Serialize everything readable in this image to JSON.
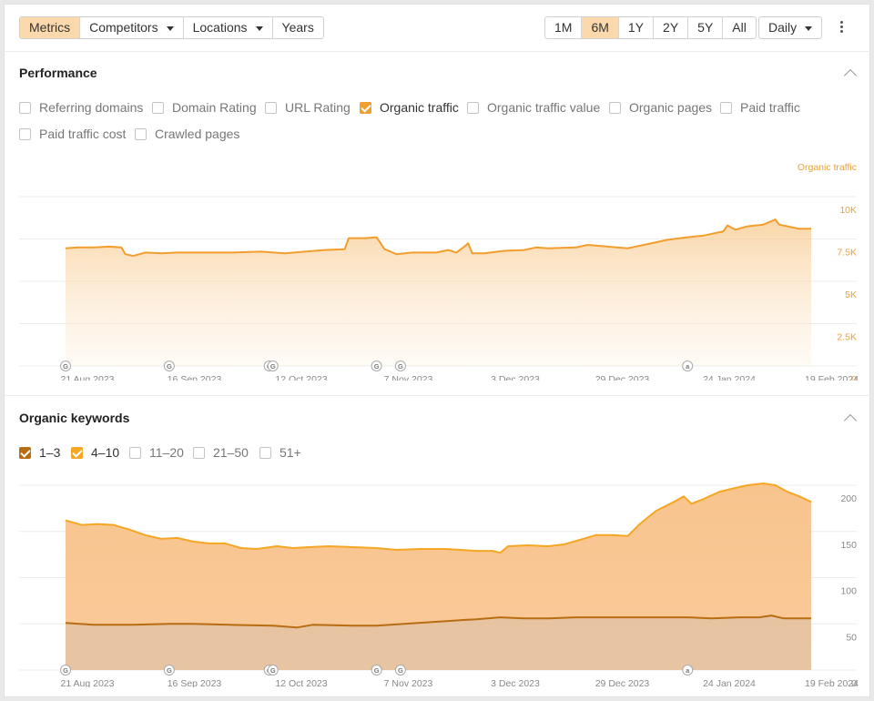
{
  "toolbar": {
    "views": [
      {
        "label": "Metrics",
        "active": true
      },
      {
        "label": "Competitors",
        "dropdown": true
      },
      {
        "label": "Locations",
        "dropdown": true
      },
      {
        "label": "Years"
      }
    ],
    "ranges": [
      {
        "label": "1M"
      },
      {
        "label": "6M",
        "active": true
      },
      {
        "label": "1Y"
      },
      {
        "label": "2Y"
      },
      {
        "label": "5Y"
      },
      {
        "label": "All"
      }
    ],
    "granularity": "Daily",
    "more_icon": "vertical-dots-icon"
  },
  "performance": {
    "title": "Performance",
    "collapse_icon": "chevron-up-icon",
    "metrics": [
      {
        "label": "Referring domains",
        "checked": false
      },
      {
        "label": "Domain Rating",
        "checked": false
      },
      {
        "label": "URL Rating",
        "checked": false
      },
      {
        "label": "Organic traffic",
        "checked": true
      },
      {
        "label": "Organic traffic value",
        "checked": false
      },
      {
        "label": "Organic pages",
        "checked": false
      },
      {
        "label": "Paid traffic",
        "checked": false
      },
      {
        "label": "Paid traffic cost",
        "checked": false
      },
      {
        "label": "Crawled pages",
        "checked": false
      }
    ],
    "accent": "#f29e2e"
  },
  "keywords": {
    "title": "Organic keywords",
    "collapse_icon": "chevron-up-icon",
    "filters": [
      {
        "label": "1–3",
        "checked": true,
        "color": "#b86d12"
      },
      {
        "label": "4–10",
        "checked": true,
        "color": "#f5a623"
      },
      {
        "label": "11–20",
        "checked": false
      },
      {
        "label": "21–50",
        "checked": false
      },
      {
        "label": "51+",
        "checked": false
      }
    ]
  },
  "chart_data": [
    {
      "type": "area",
      "series": [
        {
          "name": "Organic traffic",
          "color": "#f29e2e"
        }
      ],
      "x_ticks": [
        "21 Aug 2023",
        "16 Sep 2023",
        "12 Oct 2023",
        "7 Nov 2023",
        "3 Dec 2023",
        "29 Dec 2023",
        "24 Jan 2024",
        "19 Feb 2024"
      ],
      "y_ticks": [
        "0",
        "2.5K",
        "5K",
        "7.5K",
        "10K"
      ],
      "ylim": [
        0,
        10000
      ],
      "y_axis_color": "#e8a13c",
      "annotations": [
        {
          "date": "2023-08-21",
          "label": "G"
        },
        {
          "date": "2023-09-16",
          "label": "G"
        },
        {
          "date": "2023-10-12",
          "label": "G"
        },
        {
          "date": "2023-10-12",
          "label": "G"
        },
        {
          "date": "2023-11-07",
          "label": "G"
        },
        {
          "date": "2023-11-13",
          "label": "G"
        },
        {
          "date": "2024-01-24",
          "label": "a"
        }
      ],
      "points": [
        [
          "2023-08-21",
          6950
        ],
        [
          "2023-08-24",
          7000
        ],
        [
          "2023-08-28",
          7000
        ],
        [
          "2023-09-01",
          7050
        ],
        [
          "2023-09-04",
          7000
        ],
        [
          "2023-09-05",
          6600
        ],
        [
          "2023-09-07",
          6500
        ],
        [
          "2023-09-10",
          6700
        ],
        [
          "2023-09-14",
          6650
        ],
        [
          "2023-09-18",
          6700
        ],
        [
          "2023-09-25",
          6700
        ],
        [
          "2023-10-02",
          6700
        ],
        [
          "2023-10-09",
          6750
        ],
        [
          "2023-10-15",
          6650
        ],
        [
          "2023-10-20",
          6750
        ],
        [
          "2023-10-25",
          6850
        ],
        [
          "2023-10-30",
          6900
        ],
        [
          "2023-10-31",
          7550
        ],
        [
          "2023-11-04",
          7550
        ],
        [
          "2023-11-07",
          7600
        ],
        [
          "2023-11-09",
          6900
        ],
        [
          "2023-11-12",
          6600
        ],
        [
          "2023-11-16",
          6700
        ],
        [
          "2023-11-22",
          6700
        ],
        [
          "2023-11-25",
          6850
        ],
        [
          "2023-11-27",
          6700
        ],
        [
          "2023-11-29",
          7050
        ],
        [
          "2023-11-30",
          7250
        ],
        [
          "2023-12-01",
          6650
        ],
        [
          "2023-12-04",
          6650
        ],
        [
          "2023-12-09",
          6800
        ],
        [
          "2023-12-14",
          6850
        ],
        [
          "2023-12-17",
          7000
        ],
        [
          "2023-12-20",
          6950
        ],
        [
          "2023-12-27",
          7000
        ],
        [
          "2023-12-30",
          7150
        ],
        [
          "2024-01-04",
          7050
        ],
        [
          "2024-01-09",
          6950
        ],
        [
          "2024-01-14",
          7200
        ],
        [
          "2024-01-19",
          7450
        ],
        [
          "2024-01-24",
          7600
        ],
        [
          "2024-01-28",
          7700
        ],
        [
          "2024-02-02",
          7950
        ],
        [
          "2024-02-03",
          8300
        ],
        [
          "2024-02-05",
          8050
        ],
        [
          "2024-02-08",
          8250
        ],
        [
          "2024-02-12",
          8350
        ],
        [
          "2024-02-15",
          8650
        ],
        [
          "2024-02-16",
          8350
        ],
        [
          "2024-02-19",
          8200
        ],
        [
          "2024-02-21",
          8100
        ],
        [
          "2024-02-24",
          8100
        ]
      ]
    },
    {
      "type": "area",
      "series": [
        {
          "name": "4–10",
          "color": "#f5a623"
        },
        {
          "name": "1–3",
          "color": "#b86d12"
        }
      ],
      "x_ticks": [
        "21 Aug 2023",
        "16 Sep 2023",
        "12 Oct 2023",
        "7 Nov 2023",
        "3 Dec 2023",
        "29 Dec 2023",
        "24 Jan 2024",
        "19 Feb 2024"
      ],
      "y_ticks": [
        "0",
        "50",
        "100",
        "150",
        "200"
      ],
      "ylim": [
        0,
        200
      ],
      "annotations": [
        {
          "date": "2023-08-21",
          "label": "G"
        },
        {
          "date": "2023-09-16",
          "label": "G"
        },
        {
          "date": "2023-10-12",
          "label": "G"
        },
        {
          "date": "2023-10-12",
          "label": "G"
        },
        {
          "date": "2023-11-07",
          "label": "G"
        },
        {
          "date": "2023-11-13",
          "label": "G"
        },
        {
          "date": "2024-01-24",
          "label": "a"
        }
      ],
      "total_points": [
        [
          "2023-08-21",
          162
        ],
        [
          "2023-08-25",
          157
        ],
        [
          "2023-08-29",
          158
        ],
        [
          "2023-09-02",
          157
        ],
        [
          "2023-09-06",
          152
        ],
        [
          "2023-09-10",
          146
        ],
        [
          "2023-09-14",
          142
        ],
        [
          "2023-09-18",
          143
        ],
        [
          "2023-09-22",
          139
        ],
        [
          "2023-09-26",
          137
        ],
        [
          "2023-09-30",
          137
        ],
        [
          "2023-10-04",
          132
        ],
        [
          "2023-10-08",
          131
        ],
        [
          "2023-10-13",
          134
        ],
        [
          "2023-10-17",
          132
        ],
        [
          "2023-10-21",
          133
        ],
        [
          "2023-10-26",
          134
        ],
        [
          "2023-11-01",
          133
        ],
        [
          "2023-11-07",
          132
        ],
        [
          "2023-11-12",
          130
        ],
        [
          "2023-11-18",
          131
        ],
        [
          "2023-11-24",
          131
        ],
        [
          "2023-11-28",
          130
        ],
        [
          "2023-12-02",
          129
        ],
        [
          "2023-12-06",
          129
        ],
        [
          "2023-12-08",
          127
        ],
        [
          "2023-12-10",
          134
        ],
        [
          "2023-12-15",
          135
        ],
        [
          "2023-12-20",
          134
        ],
        [
          "2023-12-24",
          136
        ],
        [
          "2023-12-28",
          141
        ],
        [
          "2024-01-01",
          146
        ],
        [
          "2024-01-05",
          146
        ],
        [
          "2024-01-09",
          145
        ],
        [
          "2024-01-12",
          158
        ],
        [
          "2024-01-16",
          172
        ],
        [
          "2024-01-21",
          183
        ],
        [
          "2024-01-23",
          188
        ],
        [
          "2024-01-25",
          180
        ],
        [
          "2024-01-28",
          185
        ],
        [
          "2024-02-01",
          193
        ],
        [
          "2024-02-05",
          197
        ],
        [
          "2024-02-08",
          200
        ],
        [
          "2024-02-12",
          202
        ],
        [
          "2024-02-15",
          200
        ],
        [
          "2024-02-18",
          193
        ],
        [
          "2024-02-21",
          188
        ],
        [
          "2024-02-24",
          182
        ]
      ],
      "top3_points": [
        [
          "2023-08-21",
          51
        ],
        [
          "2023-08-28",
          49
        ],
        [
          "2023-09-07",
          49
        ],
        [
          "2023-09-16",
          50
        ],
        [
          "2023-09-22",
          50
        ],
        [
          "2023-10-01",
          49
        ],
        [
          "2023-10-12",
          48
        ],
        [
          "2023-10-18",
          46
        ],
        [
          "2023-10-22",
          49
        ],
        [
          "2023-11-01",
          48
        ],
        [
          "2023-11-07",
          48
        ],
        [
          "2023-11-14",
          50
        ],
        [
          "2023-11-21",
          52
        ],
        [
          "2023-11-28",
          54
        ],
        [
          "2023-12-02",
          55
        ],
        [
          "2023-12-08",
          57
        ],
        [
          "2023-12-14",
          56
        ],
        [
          "2023-12-20",
          56
        ],
        [
          "2023-12-27",
          57
        ],
        [
          "2024-01-02",
          57
        ],
        [
          "2024-01-09",
          57
        ],
        [
          "2024-01-16",
          57
        ],
        [
          "2024-01-24",
          57
        ],
        [
          "2024-01-30",
          56
        ],
        [
          "2024-02-06",
          57
        ],
        [
          "2024-02-11",
          57
        ],
        [
          "2024-02-14",
          59
        ],
        [
          "2024-02-17",
          56
        ],
        [
          "2024-02-24",
          56
        ]
      ]
    }
  ]
}
